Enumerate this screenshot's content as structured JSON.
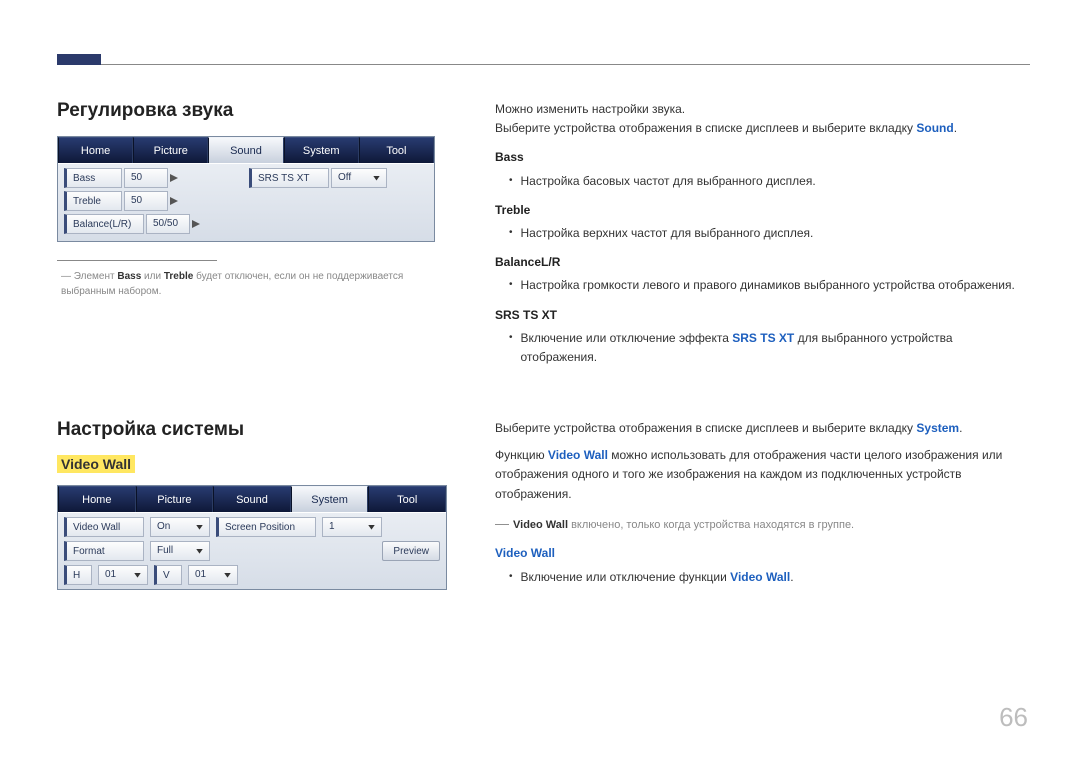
{
  "page_number": "66",
  "section1": {
    "title": "Регулировка звука",
    "tabs": [
      "Home",
      "Picture",
      "Sound",
      "System",
      "Tool"
    ],
    "active_tab_index": 2,
    "left_fields": [
      {
        "label": "Bass",
        "value": "50"
      },
      {
        "label": "Treble",
        "value": "50"
      },
      {
        "label": "Balance(L/R)",
        "value": "50/50"
      }
    ],
    "right_fields": [
      {
        "label": "SRS TS XT",
        "value": "Off"
      }
    ],
    "footnote_prefix": "― Элемент ",
    "footnote_b1": "Bass",
    "footnote_mid": " или ",
    "footnote_b2": "Treble",
    "footnote_suffix": " будет отключен, если он не поддерживается выбранным набором.",
    "intro1": "Можно изменить настройки звука.",
    "intro2_a": "Выберите устройства отображения в списке дисплеев и выберите вкладку ",
    "intro2_kw": "Sound",
    "intro2_b": ".",
    "items": [
      {
        "head": "Bass",
        "text": "Настройка басовых частот для выбранного дисплея."
      },
      {
        "head": "Treble",
        "text": "Настройка верхних частот для выбранного дисплея."
      },
      {
        "head": "BalanceL/R",
        "text": "Настройка громкости левого и правого динамиков выбранного устройства отображения."
      }
    ],
    "srs": {
      "head": "SRS TS XT",
      "text_a": "Включение или отключение эффекта ",
      "kw": "SRS TS XT",
      "text_b": " для выбранного устройства отображения."
    }
  },
  "section2": {
    "title": "Настройка системы",
    "videowall_label": "Video Wall",
    "tabs": [
      "Home",
      "Picture",
      "Sound",
      "System",
      "Tool"
    ],
    "active_tab_index": 3,
    "row1": {
      "f1_label": "Video Wall",
      "f1_value": "On",
      "f2_label": "Screen Position",
      "f2_value": "1"
    },
    "row2": {
      "f1_label": "Format",
      "f1_value": "Full",
      "preview": "Preview"
    },
    "row3": {
      "f1_label": "H",
      "f1_value": "01",
      "f2_label": "V",
      "f2_value": "01"
    },
    "intro_a": "Выберите устройства отображения в списке дисплеев и выберите вкладку ",
    "intro_kw": "System",
    "intro_b": ".",
    "body_a": "Функцию ",
    "body_kw": "Video Wall",
    "body_b": " можно использовать для отображения части целого изображения или отображения одного и того же изображения на каждом из подключенных устройств отображения.",
    "note_a": "Video Wall",
    "note_b": " включено, только когда устройства находятся в группе.",
    "item_head": "Video Wall",
    "item_text_a": "Включение или отключение функции ",
    "item_kw": "Video Wall",
    "item_text_b": "."
  }
}
